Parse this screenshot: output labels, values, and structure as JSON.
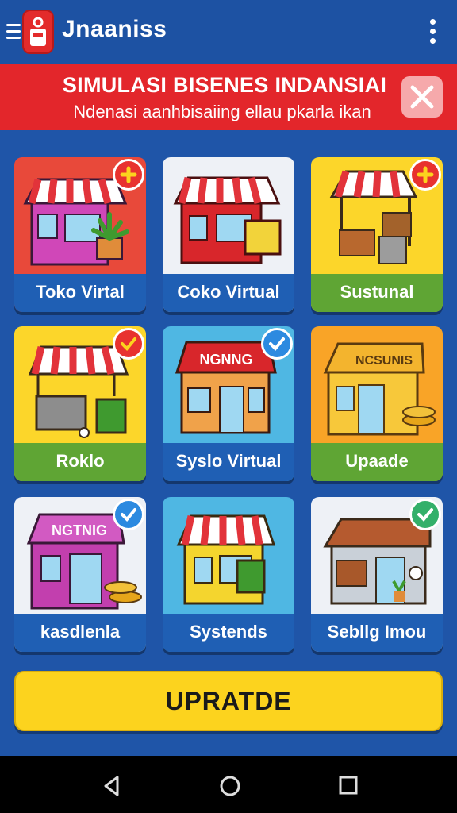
{
  "app": {
    "title": "Jnaaniss"
  },
  "banner": {
    "title": "SIMULASI BISENES INDANSIAI",
    "subtitle": "Ndenasi aanhbisaiing ellau pkarla ikan"
  },
  "cards": [
    {
      "label": "Toko Virtal",
      "bg": "#e8493a",
      "footer": "#1f5fb4",
      "badge": "plus"
    },
    {
      "label": "Coko Virtual",
      "bg": "#eef1f6",
      "footer": "#1f5fb4",
      "badge": ""
    },
    {
      "label": "Sustunal",
      "bg": "#fcd62a",
      "footer": "#5fa534",
      "badge": "plus"
    },
    {
      "label": "Roklo",
      "bg": "#fcd62a",
      "footer": "#5fa534",
      "badge": "check-red"
    },
    {
      "label": "Syslo Virtual",
      "bg": "#4fb7e3",
      "footer": "#1f5fb4",
      "badge": "check-blue"
    },
    {
      "label": "Upaade",
      "bg": "#f9a427",
      "footer": "#5fa534",
      "badge": ""
    },
    {
      "label": "kasdlenla",
      "bg": "#eef1f6",
      "footer": "#1f5fb4",
      "badge": "check-blue"
    },
    {
      "label": "Systends",
      "bg": "#4fb7e3",
      "footer": "#1f5fb4",
      "badge": ""
    },
    {
      "label": "Sebllg Imou",
      "bg": "#eef1f6",
      "footer": "#1f5fb4",
      "badge": "check-green"
    }
  ],
  "signs": {
    "card4": "NGNNG",
    "card5": "NCSUNIS",
    "card6": "NGTNIG"
  },
  "actions": {
    "primary_label": "UPRATDE"
  },
  "colors": {
    "appbar": "#1d52a3",
    "banner": "#e3262b",
    "button": "#fcd31e"
  },
  "icons": {
    "menu": "hamburger-icon",
    "overflow": "more-vert-icon",
    "close": "close-icon",
    "back": "back-triangle-icon",
    "home": "home-circle-icon",
    "recent": "recents-square-icon"
  }
}
